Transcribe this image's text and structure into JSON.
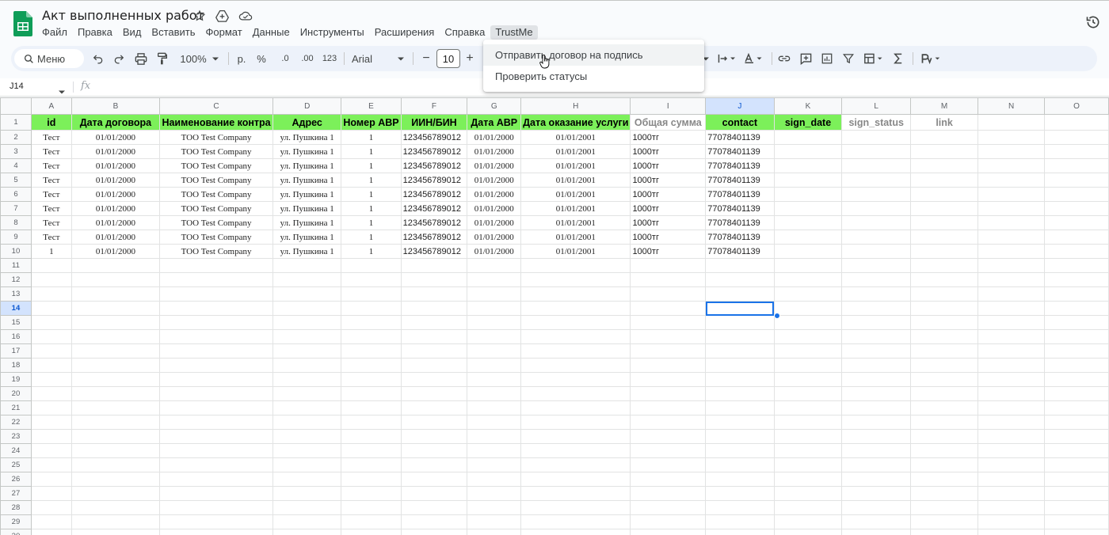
{
  "app": {
    "title": "Акт выполненных работ"
  },
  "menu": [
    "Файл",
    "Правка",
    "Вид",
    "Вставить",
    "Формат",
    "Данные",
    "Инструменты",
    "Расширения",
    "Справка",
    "TrustMe"
  ],
  "toolbar": {
    "search_label": "Меню",
    "zoom": "100%",
    "currency": "р.",
    "percent": "%",
    "dec_decrease": ".0",
    "dec_increase": ".00",
    "number_format": "123",
    "font": "Arial",
    "font_size": "10",
    "minus": "−",
    "plus": "+"
  },
  "formula_bar": {
    "cell_ref": "J14",
    "fx": "fx"
  },
  "dropdown": {
    "items": [
      "Отправить договор на подпись",
      "Проверить статусы"
    ]
  },
  "sheet": {
    "columns": [
      "A",
      "B",
      "C",
      "D",
      "E",
      "F",
      "G",
      "H",
      "I",
      "J",
      "K",
      "L",
      "M",
      "N",
      "O"
    ],
    "selected_column": "J",
    "selected_row": "14",
    "headers": [
      "id",
      "Дата договора",
      "Наименование контра",
      "Адрес",
      "Номер АВР",
      "ИИН/БИН",
      "Дата АВР",
      "Дата оказание услуги",
      "Общая сумма",
      "contact",
      "sign_date",
      "sign_status",
      "link"
    ],
    "rows": [
      [
        "Тест",
        "01/01/2000",
        "ТОО Test Company",
        "ул. Пушкина 1",
        "1",
        "123456789012",
        "01/01/2000",
        "01/01/2001",
        "1000тг",
        "77078401139"
      ],
      [
        "Тест",
        "01/01/2000",
        "ТОО Test Company",
        "ул. Пушкина 1",
        "1",
        "123456789012",
        "01/01/2000",
        "01/01/2001",
        "1000тг",
        "77078401139"
      ],
      [
        "Тест",
        "01/01/2000",
        "ТОО Test Company",
        "ул. Пушкина 1",
        "1",
        "123456789012",
        "01/01/2000",
        "01/01/2001",
        "1000тг",
        "77078401139"
      ],
      [
        "Тест",
        "01/01/2000",
        "ТОО Test Company",
        "ул. Пушкина 1",
        "1",
        "123456789012",
        "01/01/2000",
        "01/01/2001",
        "1000тг",
        "77078401139"
      ],
      [
        "Тест",
        "01/01/2000",
        "ТОО Test Company",
        "ул. Пушкина 1",
        "1",
        "123456789012",
        "01/01/2000",
        "01/01/2001",
        "1000тг",
        "77078401139"
      ],
      [
        "Тест",
        "01/01/2000",
        "ТОО Test Company",
        "ул. Пушкина 1",
        "1",
        "123456789012",
        "01/01/2000",
        "01/01/2001",
        "1000тг",
        "77078401139"
      ],
      [
        "Тест",
        "01/01/2000",
        "ТОО Test Company",
        "ул. Пушкина 1",
        "1",
        "123456789012",
        "01/01/2000",
        "01/01/2001",
        "1000тг",
        "77078401139"
      ],
      [
        "Тест",
        "01/01/2000",
        "ТОО Test Company",
        "ул. Пушкина 1",
        "1",
        "123456789012",
        "01/01/2000",
        "01/01/2001",
        "1000тг",
        "77078401139"
      ],
      [
        "1",
        "01/01/2000",
        "ТОО Test Company",
        "ул. Пушкина 1",
        "1",
        "123456789012",
        "01/01/2000",
        "01/01/2001",
        "1000тг",
        "77078401139"
      ]
    ],
    "row_numbers": [
      "1",
      "2",
      "3",
      "4",
      "5",
      "6",
      "7",
      "8",
      "9",
      "10",
      "11",
      "12",
      "13",
      "14",
      "15",
      "16",
      "17",
      "18",
      "19",
      "20",
      "21",
      "22",
      "23",
      "24",
      "25",
      "26",
      "27",
      "28",
      "29",
      "30"
    ]
  },
  "colors": {
    "header_green": "#7cf05a",
    "selection_blue": "#1a73e8",
    "sheets_green": "#0f9d58"
  }
}
